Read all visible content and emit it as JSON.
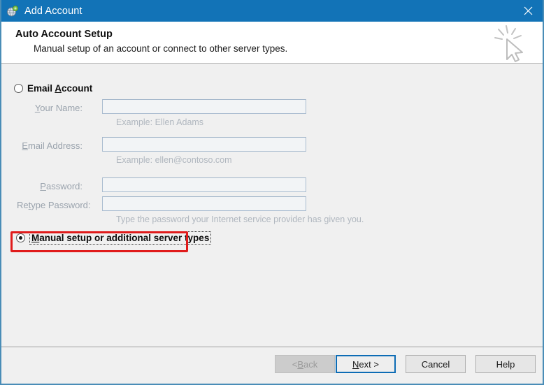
{
  "window": {
    "title": "Add Account",
    "icon": "add-account-globe-icon",
    "close_label": "✕",
    "border_color": "#4a8db7",
    "titlebar_color": "#1273b7"
  },
  "header": {
    "title": "Auto Account Setup",
    "subtitle": "Manual setup of an account or connect to other server types.",
    "watermark_icon": "mouse-cursor-click-icon"
  },
  "form": {
    "email_account_option": {
      "label_before": "Email ",
      "label_accel": "A",
      "label_after": "ccount",
      "selected": false
    },
    "fields": [
      {
        "label_before": "",
        "label_accel": "Y",
        "label_after": "our Name:",
        "value": "",
        "hint": "Example: Ellen Adams"
      },
      {
        "label_before": "",
        "label_accel": "E",
        "label_after": "mail Address:",
        "value": "",
        "hint": "Example: ellen@contoso.com"
      },
      {
        "label_before": "",
        "label_accel": "P",
        "label_after": "assword:",
        "value": "",
        "hint": ""
      },
      {
        "label_before": "Re",
        "label_accel": "t",
        "label_after": "ype Password:",
        "value": "",
        "hint": "Type the password your Internet service provider has given you."
      }
    ],
    "manual_setup_option": {
      "label_before": "",
      "label_accel": "M",
      "label_after": "anual setup or additional server types",
      "selected": true,
      "focused": true,
      "highlight_color": "#e01b1b"
    }
  },
  "footer": {
    "buttons": [
      {
        "name": "back",
        "label_before": "< ",
        "label_accel": "B",
        "label_after": "ack",
        "state": "disabled"
      },
      {
        "name": "next",
        "label_before": "",
        "label_accel": "N",
        "label_after": "ext >",
        "state": "default"
      },
      {
        "name": "cancel",
        "label_before": "Cancel",
        "label_accel": "",
        "label_after": "",
        "state": "normal"
      },
      {
        "name": "help",
        "label_before": "Help",
        "label_accel": "",
        "label_after": "",
        "state": "normal"
      }
    ]
  }
}
